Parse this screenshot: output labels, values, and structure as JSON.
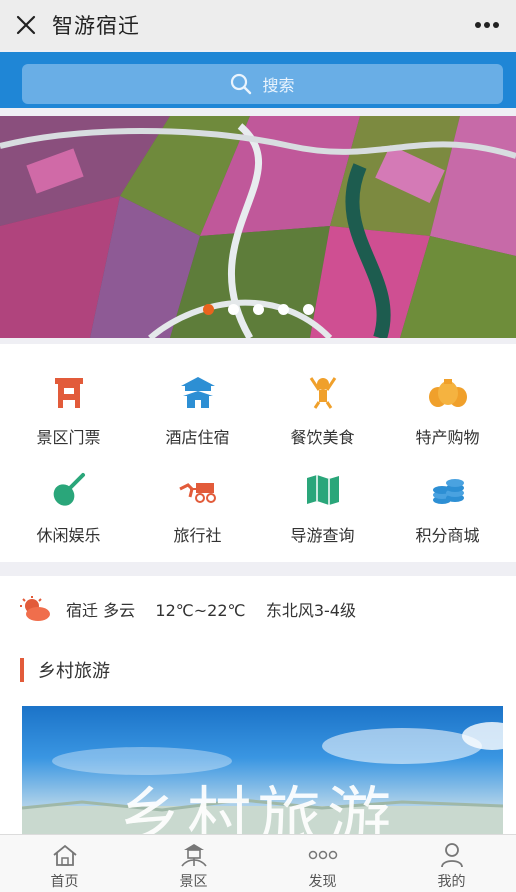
{
  "header": {
    "title": "智游宿迁"
  },
  "search": {
    "placeholder": "搜索"
  },
  "banner": {
    "slide_count": 5,
    "active_index": 0
  },
  "services": [
    {
      "label": "景区门票",
      "icon": "ticket-gate-icon",
      "color": "#e25b3a"
    },
    {
      "label": "酒店住宿",
      "icon": "hotel-pagoda-icon",
      "color": "#2d8fd4"
    },
    {
      "label": "餐饮美食",
      "icon": "chef-icon",
      "color": "#f0a02b"
    },
    {
      "label": "特产购物",
      "icon": "money-bags-icon",
      "color": "#f0a02b"
    },
    {
      "label": "休闲娱乐",
      "icon": "pipa-instrument-icon",
      "color": "#2aa67a"
    },
    {
      "label": "旅行社",
      "icon": "horse-carriage-icon",
      "color": "#e25b3a"
    },
    {
      "label": "导游查询",
      "icon": "map-icon",
      "color": "#2aa67a"
    },
    {
      "label": "积分商城",
      "icon": "coins-icon",
      "color": "#2d8fd4"
    }
  ],
  "weather": {
    "icon": "cloudy-sun-icon",
    "text": "宿迁 多云    12℃~22℃    东北风3-4级"
  },
  "section": {
    "title": "乡村旅游",
    "banner_text": "乡村旅游"
  },
  "tabs": [
    {
      "label": "首页",
      "icon": "home-icon"
    },
    {
      "label": "景区",
      "icon": "scenic-icon"
    },
    {
      "label": "发现",
      "icon": "discover-dots-icon"
    },
    {
      "label": "我的",
      "icon": "user-icon"
    }
  ],
  "colors": {
    "primary": "#1f86d6",
    "accent": "#e25b3a",
    "dot_active": "#e9641e"
  }
}
